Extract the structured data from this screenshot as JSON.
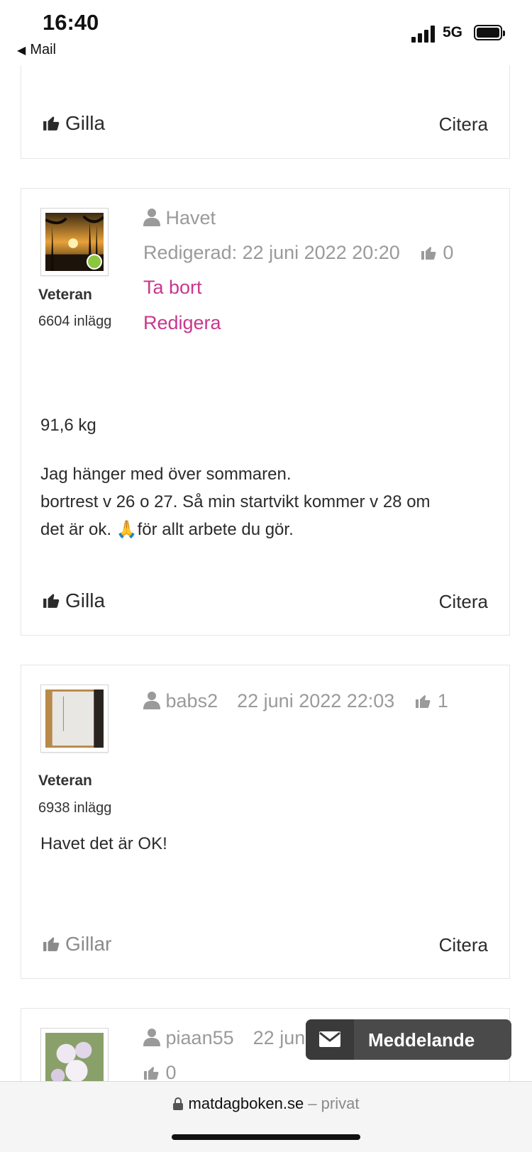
{
  "status_bar": {
    "time": "16:40",
    "back_label": "Mail",
    "network": "5G"
  },
  "posts": [
    {
      "like_label": "Gilla",
      "quote_label": "Citera"
    },
    {
      "rank": "Veteran",
      "post_count": "6604 inlägg",
      "author": "Havet",
      "edited": "Redigerad: 22 juni 2022 20:20",
      "likes": "0",
      "delete_label": "Ta bort",
      "edit_label": "Redigera",
      "body": [
        "91,6 kg",
        "Jag hänger med över sommaren.",
        "bortrest v 26 o 27. Så min startvikt kommer v 28 om",
        "det är ok. 🙏för allt arbete du gör."
      ],
      "like_label": "Gilla",
      "quote_label": "Citera"
    },
    {
      "rank": "Veteran",
      "post_count": "6938 inlägg",
      "author": "babs2",
      "date": "22 juni 2022 22:03",
      "likes": "1",
      "body": [
        "Havet det är OK!"
      ],
      "like_label": "Gillar",
      "quote_label": "Citera"
    },
    {
      "author": "piaan55",
      "date_partial": "22 jun",
      "likes": "0"
    }
  ],
  "message_button": {
    "label": "Meddelande"
  },
  "url_bar": {
    "domain": "matdagboken.se",
    "suffix": " – privat"
  },
  "colors": {
    "link_pink": "#c8378d",
    "online_green": "#8cc63f",
    "meta_grey": "#9a9a9a"
  }
}
